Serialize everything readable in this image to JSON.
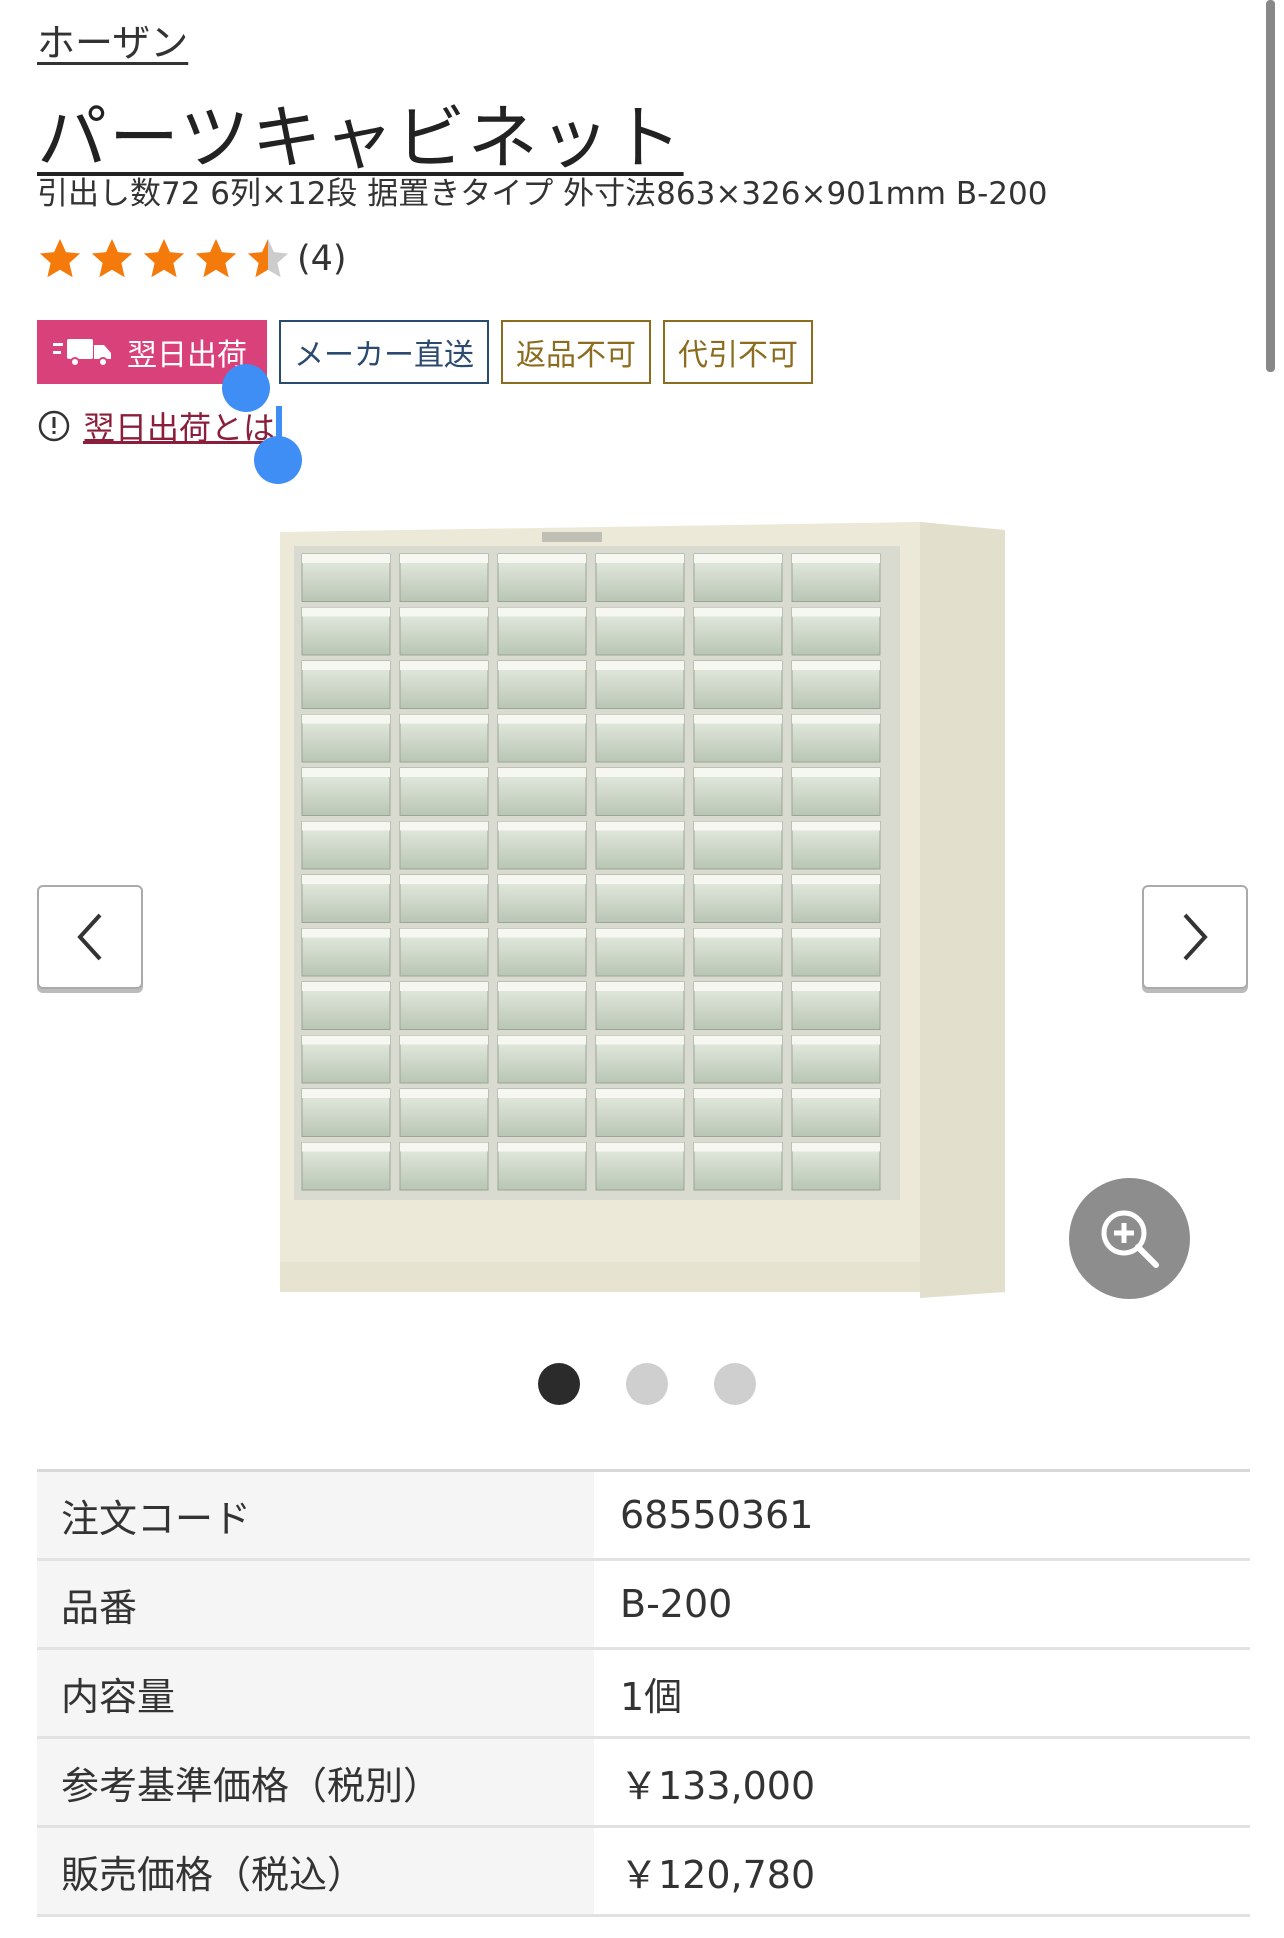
{
  "brand": "ホーザン",
  "product": {
    "title": "パーツキャビネット",
    "subtitle": "引出し数72 6列×12段 据置きタイプ 外寸法863×326×901mm B-200",
    "rating": 4.5,
    "review_count": "(4)"
  },
  "tags": {
    "next_day": "翌日出荷",
    "maker_direct": "メーカー直送",
    "no_return": "返品不可",
    "no_cod": "代引不可"
  },
  "help_link": "翌日出荷とは",
  "icons": {
    "truck": "truck-icon",
    "info": "info-circle-icon",
    "prev": "chevron-left-icon",
    "next": "chevron-right-icon",
    "zoom": "zoom-in-icon"
  },
  "carousel": {
    "total": 3,
    "active": 1
  },
  "specs": [
    {
      "key": "注文コード",
      "value": "68550361"
    },
    {
      "key": "品番",
      "value": "B-200"
    },
    {
      "key": "内容量",
      "value": "1個"
    },
    {
      "key": "参考基準価格（税別）",
      "value": "￥133,000"
    },
    {
      "key": "販売価格（税込）",
      "value": "￥120,780"
    }
  ],
  "colors": {
    "ship_tag": "#d9417b",
    "maker_tag": "#2b4a6f",
    "olive_tag": "#8c6d1f",
    "star": "#f47a0b",
    "link": "#8b1e3a",
    "selection": "#3f8ef5"
  }
}
